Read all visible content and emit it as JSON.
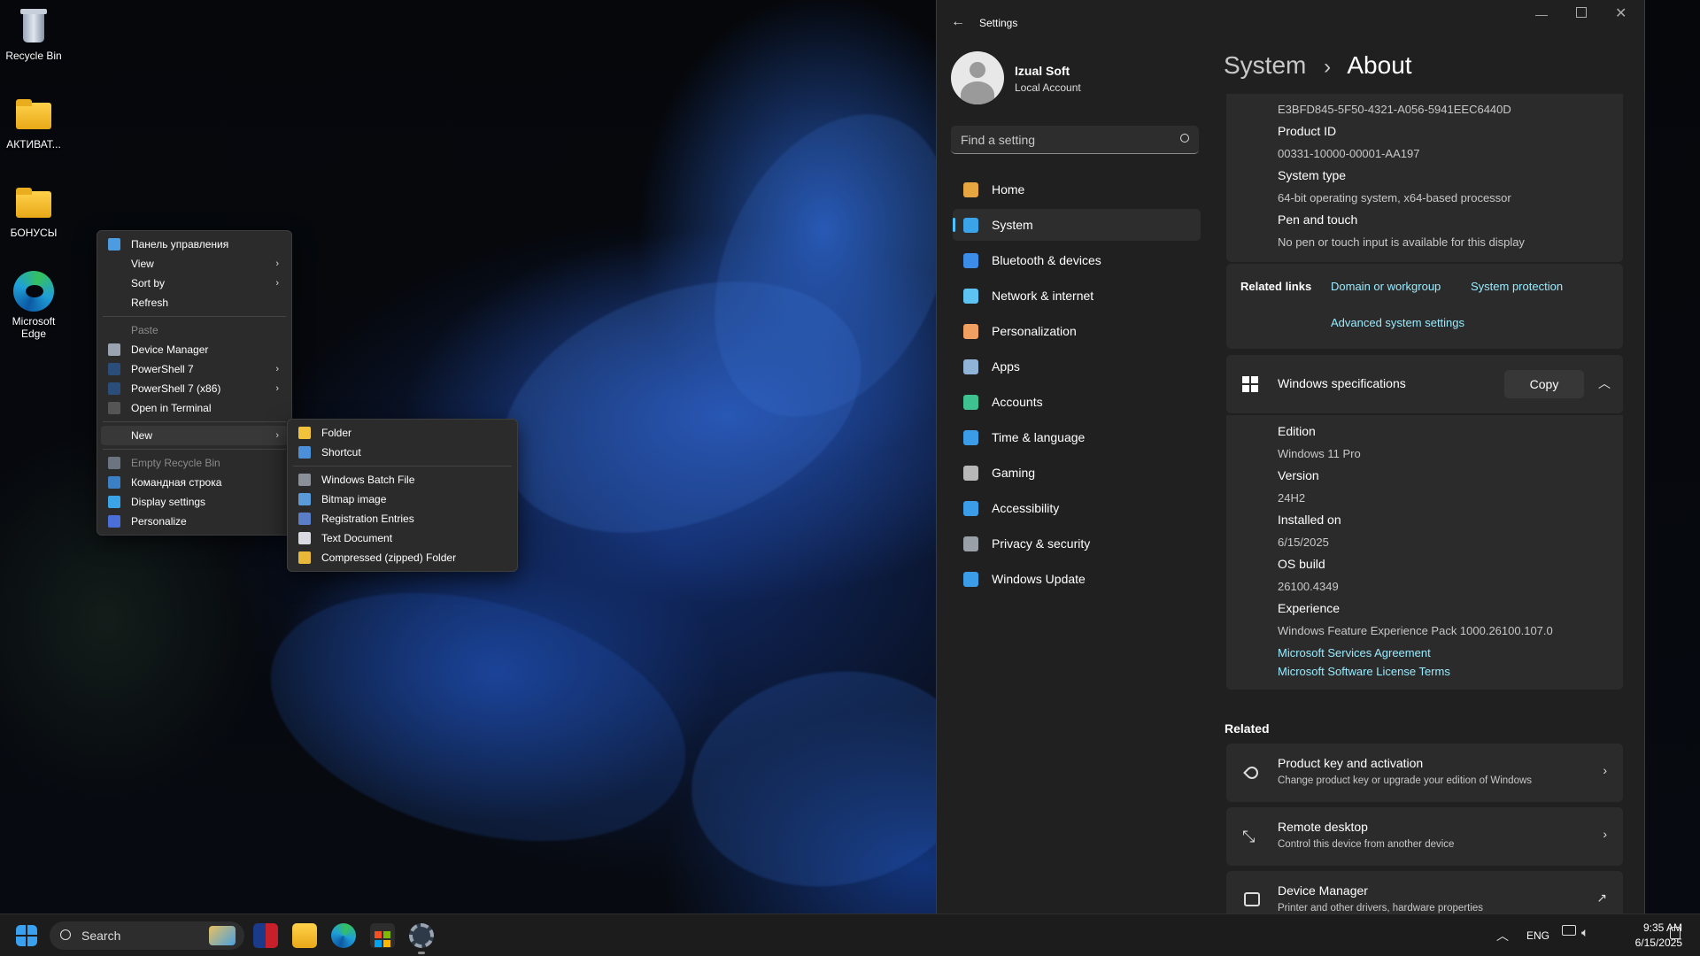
{
  "desktop": {
    "icons": [
      {
        "label": "Recycle Bin",
        "type": "recycle-bin-icon"
      },
      {
        "label": "АКТИВАТ...",
        "type": "folder-icon"
      },
      {
        "label": "БОНУСЫ",
        "type": "folder-icon"
      },
      {
        "label": "Microsoft Edge",
        "type": "edge-icon"
      }
    ]
  },
  "context_menu": {
    "items": [
      {
        "label": "Панель управления",
        "icon": "control-panel-icon"
      },
      {
        "label": "View",
        "submenu": true
      },
      {
        "label": "Sort by",
        "submenu": true
      },
      {
        "label": "Refresh"
      },
      {
        "label": "Paste",
        "disabled": true
      },
      {
        "label": "Device Manager",
        "icon": "device-manager-icon"
      },
      {
        "label": "PowerShell 7",
        "icon": "powershell-icon",
        "submenu": true
      },
      {
        "label": "PowerShell 7 (x86)",
        "icon": "powershell-icon",
        "submenu": true
      },
      {
        "label": "Open in Terminal",
        "icon": "terminal-icon"
      },
      {
        "label": "New",
        "submenu": true,
        "highlighted": true
      },
      {
        "label": "Empty Recycle Bin",
        "icon": "recycle-bin-icon",
        "disabled": true
      },
      {
        "label": "Командная строка",
        "icon": "command-prompt-icon"
      },
      {
        "label": "Display settings",
        "icon": "display-icon"
      },
      {
        "label": "Personalize",
        "icon": "personalize-icon"
      }
    ],
    "submenu_new": [
      {
        "label": "Folder",
        "icon": "folder-icon"
      },
      {
        "label": "Shortcut",
        "icon": "shortcut-icon"
      },
      {
        "label": "Windows Batch File",
        "icon": "batch-file-icon"
      },
      {
        "label": "Bitmap image",
        "icon": "bitmap-icon"
      },
      {
        "label": "Registration Entries",
        "icon": "registry-icon"
      },
      {
        "label": "Text Document",
        "icon": "text-document-icon"
      },
      {
        "label": "Compressed (zipped) Folder",
        "icon": "zip-folder-icon"
      }
    ]
  },
  "settings": {
    "window_title": "Settings",
    "user_name": "Izual Soft",
    "account_type": "Local Account",
    "search_placeholder": "Find a setting",
    "breadcrumb_parent": "System",
    "breadcrumb_sep": "›",
    "breadcrumb_current": "About",
    "nav": [
      {
        "label": "Home",
        "icon": "home-icon",
        "color": "#e8a640"
      },
      {
        "label": "System",
        "icon": "system-icon",
        "color": "#3ba3e8",
        "selected": true
      },
      {
        "label": "Bluetooth & devices",
        "icon": "bluetooth-icon",
        "color": "#3b8de8"
      },
      {
        "label": "Network & internet",
        "icon": "wifi-icon",
        "color": "#5cc3f2"
      },
      {
        "label": "Personalization",
        "icon": "brush-icon",
        "color": "#f0a060"
      },
      {
        "label": "Apps",
        "icon": "apps-icon",
        "color": "#8fb4d8"
      },
      {
        "label": "Accounts",
        "icon": "person-icon",
        "color": "#3ec28f"
      },
      {
        "label": "Time & language",
        "icon": "globe-clock-icon",
        "color": "#3b9de8"
      },
      {
        "label": "Gaming",
        "icon": "controller-icon",
        "color": "#b8b8b8"
      },
      {
        "label": "Accessibility",
        "icon": "accessibility-icon",
        "color": "#3b9de8"
      },
      {
        "label": "Privacy & security",
        "icon": "shield-icon",
        "color": "#9aa0a8"
      },
      {
        "label": "Windows Update",
        "icon": "update-icon",
        "color": "#3b9de8"
      }
    ],
    "device_specs": {
      "device_id_value": "E3BFD845-5F50-4321-A056-5941EEC6440D",
      "rows": [
        {
          "key": "Product ID",
          "value": "00331-10000-00001-AA197"
        },
        {
          "key": "System type",
          "value": "64-bit operating system, x64-based processor"
        },
        {
          "key": "Pen and touch",
          "value": "No pen or touch input is available for this display"
        }
      ]
    },
    "related_links": {
      "label": "Related links",
      "links": [
        "Domain or workgroup",
        "System protection",
        "Advanced system settings"
      ]
    },
    "windows_specs": {
      "title": "Windows specifications",
      "copy_label": "Copy",
      "rows": [
        {
          "key": "Edition",
          "value": "Windows 11 Pro"
        },
        {
          "key": "Version",
          "value": "24H2"
        },
        {
          "key": "Installed on",
          "value": "6/15/2025"
        },
        {
          "key": "OS build",
          "value": "26100.4349"
        },
        {
          "key": "Experience",
          "value": "Windows Feature Experience Pack 1000.26100.107.0"
        }
      ],
      "links": [
        "Microsoft Services Agreement",
        "Microsoft Software License Terms"
      ]
    },
    "related": {
      "heading": "Related",
      "items": [
        {
          "title": "Product key and activation",
          "subtitle": "Change product key or upgrade your edition of Windows",
          "icon": "key-icon",
          "action": "›"
        },
        {
          "title": "Remote desktop",
          "subtitle": "Control this device from another device",
          "icon": "remote-desktop-icon",
          "action": "›"
        },
        {
          "title": "Device Manager",
          "subtitle": "Printer and other drivers, hardware properties",
          "icon": "device-manager-icon",
          "action": "↗"
        }
      ]
    }
  },
  "taskbar": {
    "search_label": "Search",
    "language": "ENG",
    "time": "9:35 AM",
    "date": "6/15/2025"
  }
}
